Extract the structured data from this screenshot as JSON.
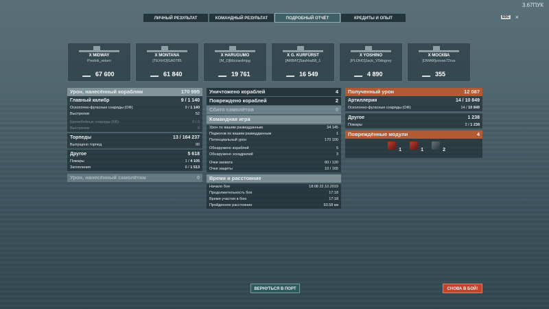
{
  "version": "3.67ПУК",
  "esc": {
    "key": "ESC",
    "close": "×"
  },
  "tabs": [
    {
      "label": "ЛИЧНЫЙ РЕЗУЛЬТАТ"
    },
    {
      "label": "КОМАНДНЫЙ РЕЗУЛЬТАТ"
    },
    {
      "label": "ПОДРОБНЫЙ ОТЧЁТ"
    },
    {
      "label": "КРЕДИТЫ И ОПЫТ"
    }
  ],
  "ships": [
    {
      "name": "X MIDWAY",
      "player": "Predok_return",
      "damage": "67 600"
    },
    {
      "name": "X MONTANA",
      "player": "[TEXHO]GA0785",
      "damage": "61 840"
    },
    {
      "name": "X HARUGUMO",
      "player": "[M_O]blizzardmpg",
      "damage": "19 761"
    },
    {
      "name": "X G. KURFÜRST",
      "player": "[ARBAT]Sashka58_1",
      "damage": "16 549"
    },
    {
      "name": "X YOSHINO",
      "player": "[PLOHO]Jack_V0dogrey",
      "damage": "4 890"
    },
    {
      "name": "X МОСКВА",
      "player": "[OMAR]vovan72rus",
      "damage": "355"
    }
  ],
  "left": {
    "damage_ships": {
      "label": "Урон, нанесённый кораблям",
      "value": "170 995"
    },
    "main_cal": {
      "label": "Главный калибр",
      "hits": "9",
      "value": "1 140"
    },
    "he": {
      "label": "Осколочно-фугасные снаряды (ОФ)",
      "hits": "9",
      "value": "1 140"
    },
    "he_shots": {
      "label": "Выстрелов",
      "value": "52"
    },
    "ap": {
      "label": "Бронебойные снаряды (ББ)",
      "hits": "0",
      "value": "0"
    },
    "ap_shots": {
      "label": "Выстрелов",
      "value": "0"
    },
    "torps": {
      "label": "Торпеды",
      "hits": "13",
      "value": "164 237"
    },
    "torps_fired": {
      "label": "Выпущено торпед",
      "value": "90"
    },
    "other": {
      "label": "Другое",
      "value": "5 618"
    },
    "fires": {
      "label": "Пожары",
      "hits": "1",
      "value": "4 105"
    },
    "floods": {
      "label": "Затопления",
      "hits": "6",
      "value": "1 513"
    },
    "damage_planes": {
      "label": "Урон, нанесённый самолётам",
      "value": "0"
    }
  },
  "mid": {
    "destroyed": {
      "label": "Уничтожено кораблей",
      "value": "4"
    },
    "damaged": {
      "label": "Повреждено кораблей",
      "value": "2"
    },
    "planes": {
      "label": "Сбито самолётов",
      "value": "0"
    },
    "team": {
      "label": "Командная игра"
    },
    "spot_dmg": {
      "label": "Урон по вашим разведданным",
      "value": "34 145"
    },
    "spot_fires": {
      "label": "Поджогов по вашим разведданным",
      "value": "1"
    },
    "potential": {
      "label": "Потенциальный урон",
      "value": "170 100"
    },
    "spotted_ships": {
      "label": "Обнаружено кораблей",
      "value": "5"
    },
    "spotted_sq": {
      "label": "Обнаружено эскадрилий",
      "value": "3"
    },
    "capture": {
      "label": "Очки захвата",
      "value": "60 / 120"
    },
    "defense": {
      "label": "Очки защиты",
      "value": "10 / 165"
    },
    "time": {
      "label": "Время и расстояние"
    },
    "start": {
      "label": "Начало боя",
      "value": "18:08  22.10.2019"
    },
    "duration": {
      "label": "Продолжительность боя",
      "value": "17:18"
    },
    "participation": {
      "label": "Время участия в бою",
      "value": "17:18"
    },
    "distance": {
      "label": "Пройденное расстояние",
      "value": "93.58 км"
    }
  },
  "right": {
    "received": {
      "label": "Полученный урон",
      "value": "12 087"
    },
    "artillery": {
      "label": "Артиллерия",
      "hits": "14",
      "value": "10 849"
    },
    "he": {
      "label": "Осколочно-фугасные снаряды (ОФ)",
      "hits": "14",
      "value": "10 849"
    },
    "other": {
      "label": "Другое",
      "value": "1 238"
    },
    "fires": {
      "label": "Пожары",
      "hits": "2",
      "value": "1 238"
    },
    "modules": {
      "label": "Повреждённые модули",
      "value": "4"
    },
    "module_counts": {
      "m1": "1",
      "m2": "1",
      "m3": "2"
    }
  },
  "buttons": {
    "port": "ВЕРНУТЬСЯ В ПОРТ",
    "battle": "СНОВА В БОЙ!"
  }
}
